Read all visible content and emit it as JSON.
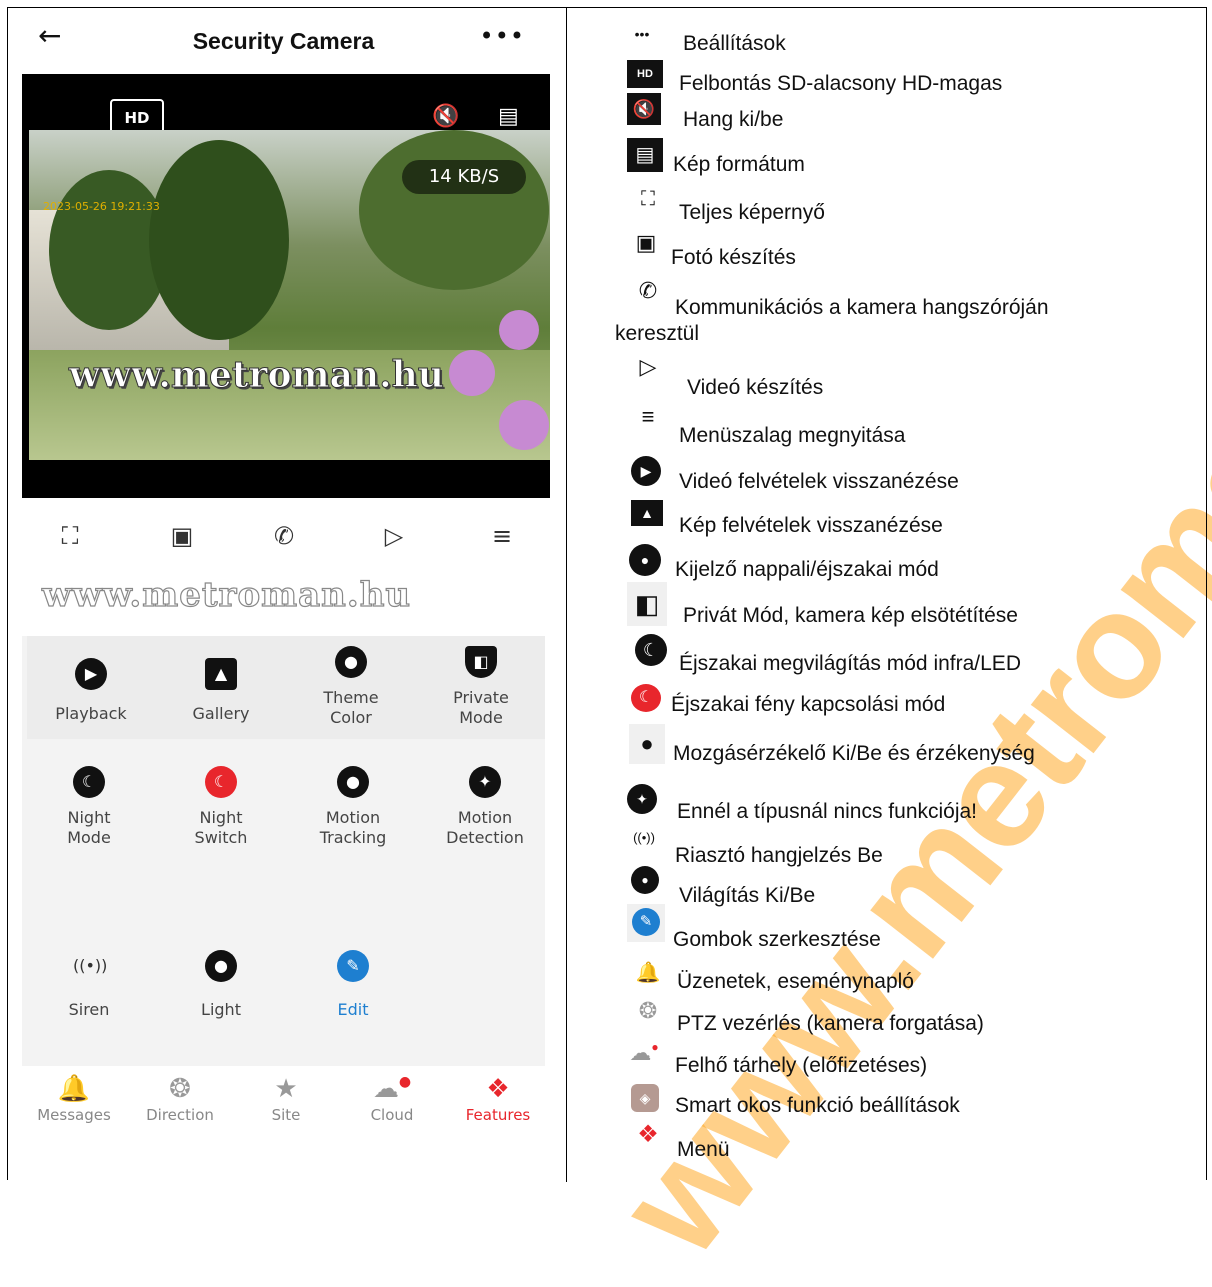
{
  "watermark": "www.metroman.hu",
  "phone": {
    "title": "Security Camera",
    "back_glyph": "←",
    "more_glyph": "•••",
    "hd_label": "HD",
    "speed": "14 KB/S",
    "timestamp": "2023-05-26 19:21:33",
    "video_watermark": "www.metroman.hu",
    "below_watermark": "www.metroman.hu",
    "features": [
      {
        "label1": "Playback",
        "label2": "",
        "icon": "play-icon"
      },
      {
        "label1": "Gallery",
        "label2": "",
        "icon": "gallery-icon"
      },
      {
        "label1": "Theme",
        "label2": "Color",
        "icon": "palette-icon"
      },
      {
        "label1": "Private",
        "label2": "Mode",
        "icon": "private-mode-icon"
      },
      {
        "label1": "Night",
        "label2": "Mode",
        "icon": "moon-icon"
      },
      {
        "label1": "Night",
        "label2": "Switch",
        "icon": "night-switch-icon"
      },
      {
        "label1": "Motion",
        "label2": "Tracking",
        "icon": "location-pin-icon"
      },
      {
        "label1": "Motion",
        "label2": "Detection",
        "icon": "walking-person-icon"
      },
      {
        "label1": "Siren",
        "label2": "",
        "icon": "siren-icon"
      },
      {
        "label1": "Light",
        "label2": "",
        "icon": "light-icon"
      },
      {
        "label1": "Edit",
        "label2": "",
        "icon": "edit-icon"
      }
    ],
    "tabs": [
      "Messages",
      "Direction",
      "Site",
      "Cloud",
      "Features"
    ],
    "colors": {
      "accent": "#e8262c",
      "edit_blue": "#1e7fd0"
    }
  },
  "legend": [
    "Beállítások",
    "Felbontás SD-alacsony HD-magas",
    "Hang ki/be",
    "Kép formátum",
    "Teljes képernyő",
    "Fotó készítés",
    "Kommunikációs a kamera hangszóróján",
    "keresztül",
    "Videó készítés",
    "Menüszalag megnyitása",
    "Videó felvételek visszanézése",
    "Kép felvételek visszanézése",
    "Kijelző nappali/éjszakai mód",
    "Privát Mód, kamera kép elsötétítése",
    "Éjszakai megvilágítás mód infra/LED",
    "Éjszakai fény kapcsolási mód",
    "Mozgásérzékelő Ki/Be és érzékenység",
    "Ennél a típusnál nincs funkciója!",
    "Riasztó hangjelzés Be",
    "Világítás Ki/Be",
    "Gombok szerkesztése",
    "Üzenetek, eseménynapló",
    "PTZ vezérlés (kamera forgatása)",
    "Felhő tárhely (előfizetéses)",
    "Smart okos funkció beállítások",
    "Menü"
  ]
}
